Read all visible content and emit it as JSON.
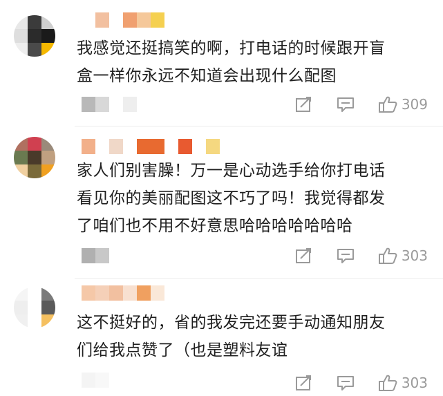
{
  "comments": [
    {
      "text_lines": [
        "我感觉还挺搞笑的啊，打电话的时候跟开盲",
        "盒一样你永远不知道会出现什么配图"
      ],
      "likes": "309",
      "avatar_colors": [
        "#e8e8e8",
        "#3b3b3b",
        "#cfcfcf",
        "#dedede",
        "#2b2b2b",
        "#1a1a1a",
        "#eeeeee",
        "#4a4a4a",
        "#f5b800"
      ],
      "name_colors": [
        "#ffffff",
        "#f2c0a0",
        "#ffffff",
        "#f0a070",
        "#f5c89a",
        "#f5d050"
      ],
      "meta_colors": [
        "#b8b8b8",
        "#d8d8d8",
        "#ffffff",
        "#eeeeee"
      ]
    },
    {
      "text_lines": [
        "家人们别害臊！万一是心动选手给你打电话",
        "看见你的美丽配图这不巧了吗！我觉得都发",
        "了咱们也不用不好意思哈哈哈哈哈哈哈"
      ],
      "likes": "303",
      "avatar_colors": [
        "#b07060",
        "#d04050",
        "#9a8a7a",
        "#6a7a50",
        "#4a3a2a",
        "#c0a080",
        "#f0d0a0",
        "#7a6a3a",
        "#f0a020"
      ],
      "name_colors": [
        "#f2b08a",
        "#ffffff",
        "#f0d8c8",
        "#ffffff",
        "#e86a30",
        "#e86a30",
        "#ffffff",
        "#e85a30",
        "#ffffff",
        "#f5d880"
      ],
      "meta_colors": [
        "#b0b0b0",
        "#c8c8c8"
      ]
    },
    {
      "text_lines": [
        "这不挺好的，省的我发完还要手动通知朋友",
        "们给我点赞了（也是塑料友谊"
      ],
      "likes": "303",
      "avatar_colors": [
        "#f5f5f5",
        "#ffffff",
        "#7a7a7a",
        "#eeeeee",
        "#ffffff",
        "#5a5a5a",
        "#f0f0f0",
        "#ffffff",
        "#f5c060"
      ],
      "name_colors": [
        "#f5c8a8",
        "#f5d0b8",
        "#f2c0a0",
        "#f8e0d0",
        "#f0a060",
        "#fae8d8"
      ],
      "meta_colors": [
        "#f4f4f4",
        "#f8f8f8"
      ]
    }
  ],
  "icons": {
    "repost": "repost-icon",
    "reply": "reply-icon",
    "like": "thumbs-up-icon"
  }
}
